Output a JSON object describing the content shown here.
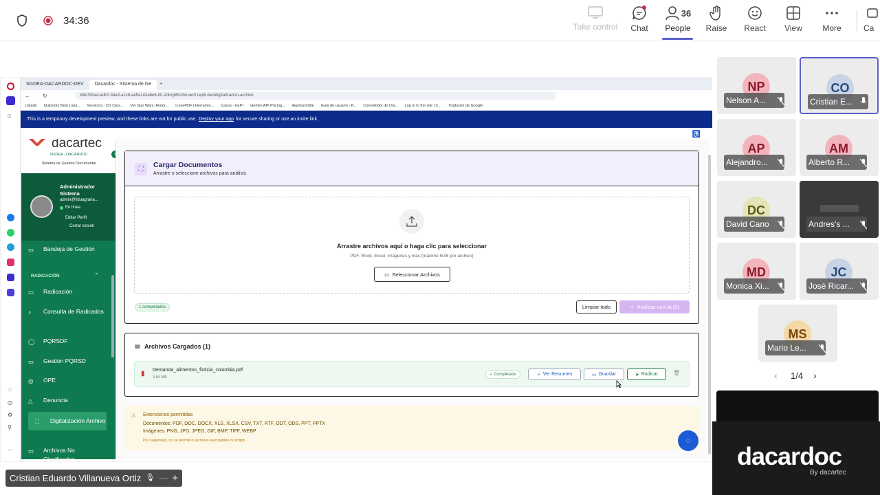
{
  "meeting": {
    "timer": "34:36",
    "presenter_name": "Cristian Eduardo Villanueva Ortiz"
  },
  "toolbar": {
    "take_control": "Take control",
    "chat": "Chat",
    "people": "People",
    "people_count": "36",
    "raise": "Raise",
    "react": "React",
    "view": "View",
    "more": "More",
    "camera_partial": "Ca"
  },
  "browser": {
    "tabs": [
      "SGDEA-DACARDOC-DEV",
      "Dacardoc - Sistema de Ge"
    ],
    "url": "b8e790a4-edb7-44a3-a1c8-eeffa143a6e6-00-2obcjh9n2ixt.worf.replit.dev/digitalizacion-archivo",
    "bookmarks": [
      "Listado",
      "Quicklotz Best Liqui...",
      "Servicios - CD Cars...",
      "Ver Star Wars: Andor...",
      "iLovePDF | Herramie...",
      "Casos - GLPI",
      "Gemini API Pricing...",
      "ApplicantSite",
      "Guía de usuario - P...",
      "Convertidor de Uni...",
      "Log in to the site | C...",
      "Traductor de Google"
    ],
    "banner_pre": "This is a temporary development preview, and these links are not for public use.",
    "banner_link": "Deploy your app",
    "banner_post": "for secure sharing or use an invite link."
  },
  "sidebar": {
    "brand": "dacartec",
    "subtitle": "SGDEA - DACARDOC",
    "tagline": "Sistema de Gestión Documental",
    "user_name": "Administrador Sistema",
    "user_email": "admin@fiduagraria...",
    "status": "En línea",
    "edit_profile": "Editar Perfil",
    "logout": "Cerrar sesión",
    "section_label": "RADICACIÓN",
    "items": [
      {
        "label": "Bandeja de Gestión"
      },
      {
        "label": "Radicación"
      },
      {
        "label": "Consulta de Radicados"
      },
      {
        "label": "PQRSDF"
      },
      {
        "label": "Gestión PQRSD"
      },
      {
        "label": "OPE"
      },
      {
        "label": "Denuncia"
      },
      {
        "label": "Digitalización Archivo"
      },
      {
        "label": "Archivos No Clasificados"
      }
    ]
  },
  "upload": {
    "title": "Cargar Documentos",
    "subtitle": "Arrastre o seleccione archivos para análisis",
    "drop_title": "Arrastre archivos aquí o haga clic para seleccionar",
    "drop_hint": "PDF, Word, Excel, imágenes y más (máximo 5GB por archivo)",
    "select_button": "Seleccionar Archivos",
    "completed_badge": "1 completados",
    "clear_button": "Limpiar todo",
    "analyze_button": "Analizar con IA (0)"
  },
  "files": {
    "title": "Archivos Cargados (1)",
    "items": [
      {
        "name": "Demanda_alimentos_ficticia_colombia.pdf",
        "size": "3.84 MB",
        "status": "Completado"
      }
    ],
    "actions": {
      "summary": "Ver Resumen",
      "save": "Guardar",
      "radicar": "Radicar"
    }
  },
  "extensions": {
    "title": "Extensiones permitidas",
    "documents": "Documentos: PDF, DOC, DOCX, XLS, XLSX, CSV, TXT, RTF, ODT, ODS, PPT, PPTX",
    "images": "Imágenes: PNG, JPG, JPEG, GIF, BMP, TIFF, WEBP",
    "note": "Por seguridad, no se permiten archivos ejecutables ni scripts."
  },
  "participants": [
    {
      "initials": "NP",
      "name": "Nelson A...",
      "color": "#f3b4bc"
    },
    {
      "initials": "CO",
      "name": "Cristian E...",
      "color": "#c7d3e6"
    },
    {
      "initials": "AP",
      "name": "Alejandro...",
      "color": "#f3b4bc"
    },
    {
      "initials": "AM",
      "name": "Alberto R...",
      "color": "#f3b4bc"
    },
    {
      "initials": "DC",
      "name": "David Cano",
      "color": "#e3e4b8"
    },
    {
      "initials": "",
      "name": "Andres's ...",
      "color": "#3a3a3a"
    },
    {
      "initials": "MD",
      "name": "Monica Xi...",
      "color": "#f3b4bc"
    },
    {
      "initials": "JC",
      "name": "José Ricar...",
      "color": "#c7d3e6"
    },
    {
      "initials": "MS",
      "name": "Mario Le...",
      "color": "#f5d8a8"
    }
  ],
  "pager": "1/4",
  "brand_tile": {
    "name_main": "dacardoc",
    "by": "By dacartec"
  },
  "colors": {
    "accent": "#5b5fc7",
    "sidebar_green": "#0f7a4f",
    "banner_blue": "#0c2b8c",
    "analyze_purple": "#d6b6f0"
  }
}
